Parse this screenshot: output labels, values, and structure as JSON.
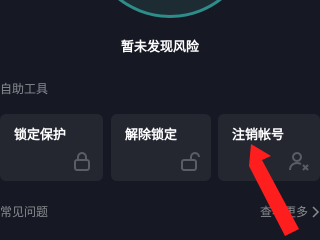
{
  "status": {
    "text": "暂未发现风险"
  },
  "self_tools": {
    "title": "自助工具",
    "items": [
      {
        "label": "锁定保护",
        "icon": "lock-icon"
      },
      {
        "label": "解除锁定",
        "icon": "unlock-icon"
      },
      {
        "label": "注销帐号",
        "icon": "user-remove-icon"
      }
    ]
  },
  "faq": {
    "title": "常见问题",
    "view_more": "查看更多"
  },
  "colors": {
    "background": "#161823",
    "card": "#242630",
    "muted_text": "#8a8b91",
    "ring": "#2e8c8a",
    "annotation_arrow": "#ff1e1e"
  }
}
